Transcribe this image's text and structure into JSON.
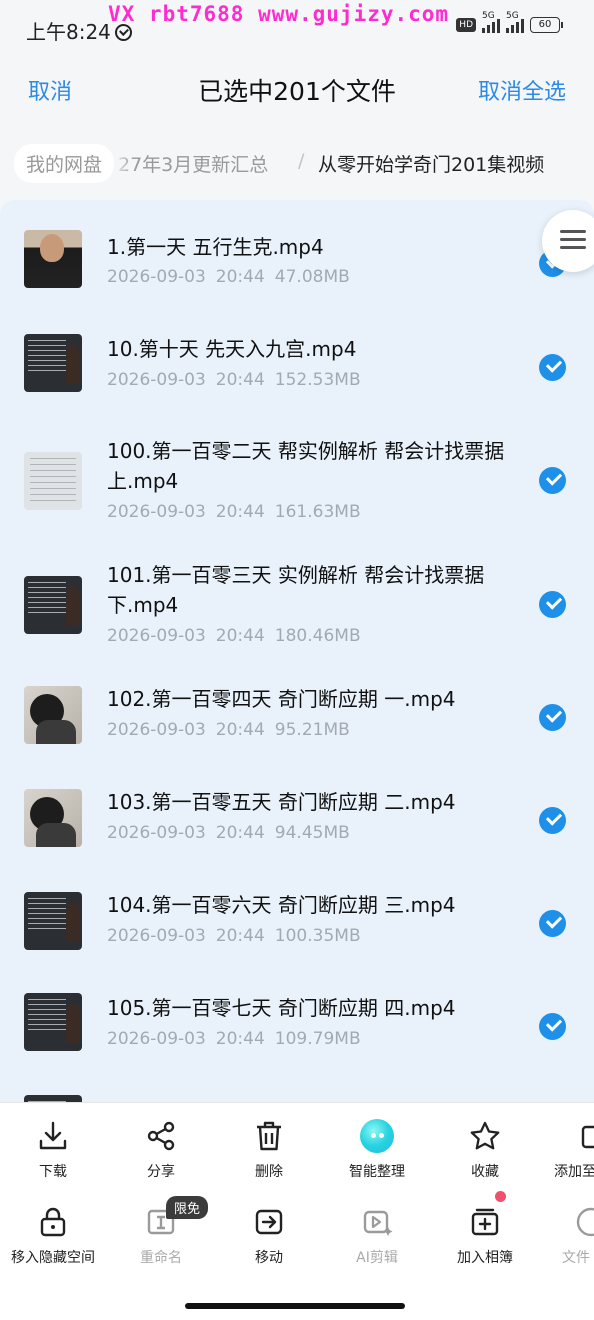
{
  "status_bar": {
    "time": "上午8:24",
    "watermark": "VX rbt7688   www.gujizy.com",
    "hd": "HD",
    "net1": "5G",
    "net2": "5G",
    "battery": "60"
  },
  "header": {
    "cancel": "取消",
    "title": "已选中201个文件",
    "select_all_cancel": "取消全选"
  },
  "breadcrumb": {
    "root": "我的网盘",
    "middle": "27年3月更新汇总",
    "separator": "/",
    "current": "从零开始学奇门201集视频"
  },
  "files": [
    {
      "name": "1.第一天  五行生克.mp4",
      "date": "2026-09-03",
      "time": "20:44",
      "size": "47.08MB",
      "thumb": "portrait",
      "checked": true
    },
    {
      "name": "10.第十天  先天入九宫.mp4",
      "date": "2026-09-03",
      "time": "20:44",
      "size": "152.53MB",
      "thumb": "board",
      "checked": true
    },
    {
      "name": "100.第一百零二天  帮实例解析 帮会计找票据 上.mp4",
      "date": "2026-09-03",
      "time": "20:44",
      "size": "161.63MB",
      "thumb": "paper",
      "checked": true
    },
    {
      "name": "101.第一百零三天  实例解析 帮会计找票据下.mp4",
      "date": "2026-09-03",
      "time": "20:44",
      "size": "180.46MB",
      "thumb": "board",
      "checked": true
    },
    {
      "name": "102.第一百零四天 奇门断应期 一.mp4",
      "date": "2026-09-03",
      "time": "20:44",
      "size": "95.21MB",
      "thumb": "person",
      "checked": true
    },
    {
      "name": "103.第一百零五天  奇门断应期 二.mp4",
      "date": "2026-09-03",
      "time": "20:44",
      "size": "94.45MB",
      "thumb": "person",
      "checked": true
    },
    {
      "name": "104.第一百零六天  奇门断应期 三.mp4",
      "date": "2026-09-03",
      "time": "20:44",
      "size": "100.35MB",
      "thumb": "board",
      "checked": true
    },
    {
      "name": "105.第一百零七天  奇门断应期  四.mp4",
      "date": "2026-09-03",
      "time": "20:44",
      "size": "109.79MB",
      "thumb": "board",
      "checked": true
    }
  ],
  "actions_row1": [
    {
      "label": "下载",
      "icon": "download-icon"
    },
    {
      "label": "分享",
      "icon": "share-icon"
    },
    {
      "label": "删除",
      "icon": "trash-icon"
    },
    {
      "label": "智能整理",
      "icon": "ai-organize-icon"
    },
    {
      "label": "收藏",
      "icon": "star-icon"
    },
    {
      "label": "添加至",
      "icon": "add-to-icon"
    }
  ],
  "actions_row2": [
    {
      "label": "移入隐藏空间",
      "icon": "lock-icon"
    },
    {
      "label": "重命名",
      "icon": "rename-icon"
    },
    {
      "label": "移动",
      "icon": "move-icon"
    },
    {
      "label": "AI剪辑",
      "icon": "ai-clip-icon"
    },
    {
      "label": "加入相簿",
      "icon": "album-add-icon"
    },
    {
      "label": "文件",
      "icon": "file-info-icon"
    }
  ],
  "badge_free": "限免",
  "colors": {
    "accent": "#2b8be6",
    "check": "#1e90ea",
    "list_bg": "#e9f2fb",
    "watermark": "#ff2bd0"
  }
}
